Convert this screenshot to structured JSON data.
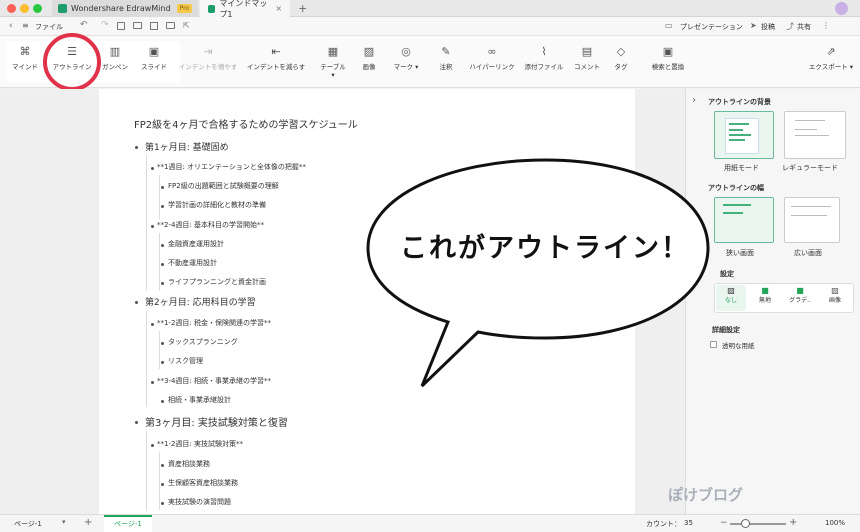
{
  "app": {
    "name": "Wondershare EdrawMind",
    "badge": "Pro",
    "doc_tab": "マインドマップ1",
    "plus": "+"
  },
  "menubar": {
    "file": "ファイル",
    "presentation": "プレゼンテーション",
    "post": "投稿",
    "share": "共有"
  },
  "ribbon": {
    "items": [
      "マインド",
      "アウトライン",
      "ガンペン",
      "スライド",
      "インデントを増やす",
      "インデントを減らす",
      "テーブル",
      "画像",
      "マーク",
      "注釈",
      "ハイパーリンク",
      "添付ファイル",
      "コメント",
      "タグ",
      "検索と置換",
      "エクスポート"
    ]
  },
  "outline": {
    "title": "FP2級を4ヶ月で合格するための学習スケジュール",
    "m1": "第1ヶ月目: 基礎固め",
    "m1w1": "**1週目: オリエンテーションと全体像の把握**",
    "m1w1a": "FP2級の出題範囲と試験概要の理解",
    "m1w1b": "学習計画の詳細化と教材の準備",
    "m1w2": "**2-4週目: 基本科目の学習開始**",
    "m1w2a": "金融資産運用設計",
    "m1w2b": "不動産運用設計",
    "m1w2c": "ライフプランニングと資金計画",
    "m2": "第2ヶ月目: 応用科目の学習",
    "m2w1": "**1-2週目: 税金・保険関連の学習**",
    "m2w1a": "タックスプランニング",
    "m2w1b": "リスク管理",
    "m2w2": "**3-4週目: 相続・事業承継の学習**",
    "m2w2a": "相続・事業承継設計",
    "m3": "第3ヶ月目: 実技試験対策と復習",
    "m3w1": "**1-2週目: 実技試験対策**",
    "m3w1a": "資産相談業務",
    "m3w1b": "生保顧客資産相談業務",
    "m3w1c": "実技試験の演習問題"
  },
  "callout": {
    "text": "これがアウトライン！"
  },
  "panel": {
    "bg_title": "アウトラインの背景",
    "paper_mode": "用紙モード",
    "regular_mode": "レギュラーモード",
    "width_title": "アウトラインの幅",
    "narrow": "狭い画面",
    "wide": "広い画面",
    "fill_title": "設定",
    "fill_none": "なし",
    "fill_solid": "無地",
    "fill_gradient": "グラデ..",
    "fill_image": "画像",
    "detail_title": "詳細設定",
    "transparent": "透明な用紙"
  },
  "status": {
    "page_select": "ページ-1",
    "page_tab": "ページ-1",
    "count_label": "カウント：",
    "count": "35",
    "zoom": "100%"
  },
  "watermark": {
    "text": "ぽけブログ"
  },
  "colors": {
    "accent": "#22a559",
    "highlight_circle": "#e0334a"
  }
}
